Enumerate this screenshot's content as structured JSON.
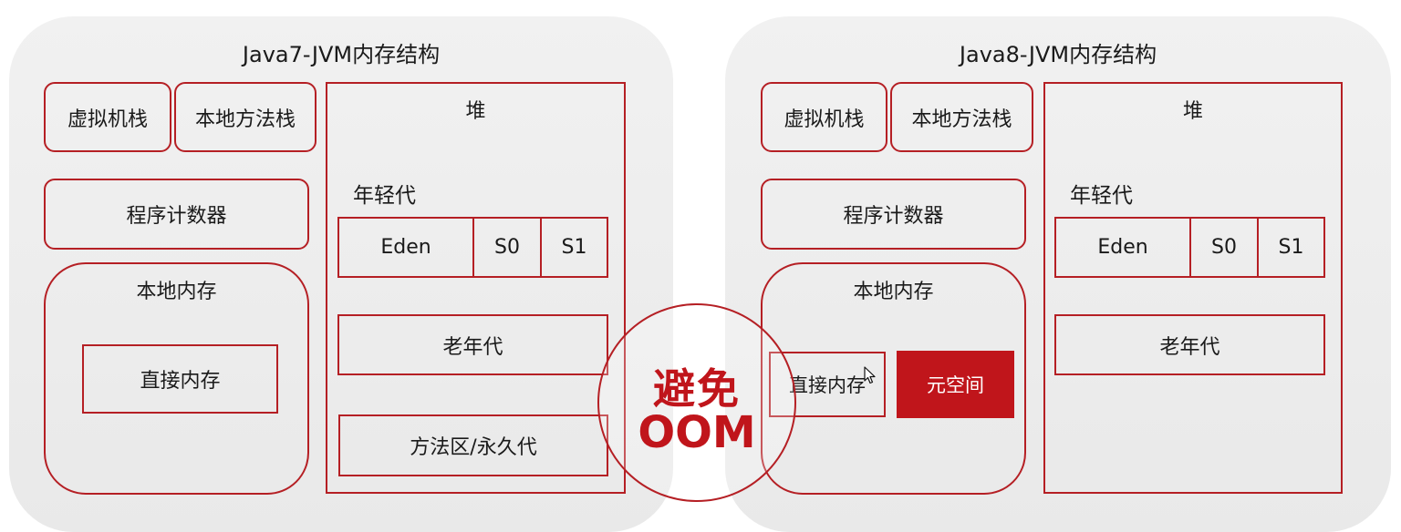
{
  "left": {
    "title": "Java7-JVM内存结构",
    "vm_stack": "虚拟机栈",
    "native_stack": "本地方法栈",
    "pc": "程序计数器",
    "native_memory": "本地内存",
    "direct_memory": "直接内存",
    "heap": "堆",
    "young_gen": "年轻代",
    "eden": "Eden",
    "s0": "S0",
    "s1": "S1",
    "old_gen": "老年代",
    "method_area": "方法区/永久代"
  },
  "right": {
    "title": "Java8-JVM内存结构",
    "vm_stack": "虚拟机栈",
    "native_stack": "本地方法栈",
    "pc": "程序计数器",
    "native_memory": "本地内存",
    "direct_memory": "直接内存",
    "metaspace": "元空间",
    "heap": "堆",
    "young_gen": "年轻代",
    "eden": "Eden",
    "s0": "S0",
    "s1": "S1",
    "old_gen": "老年代"
  },
  "badge": {
    "line1": "避免",
    "line2": "OOM"
  },
  "colors": {
    "accent": "#b51f24",
    "metaspace_fill": "#c0151b",
    "panel_bg": "#ececec"
  }
}
